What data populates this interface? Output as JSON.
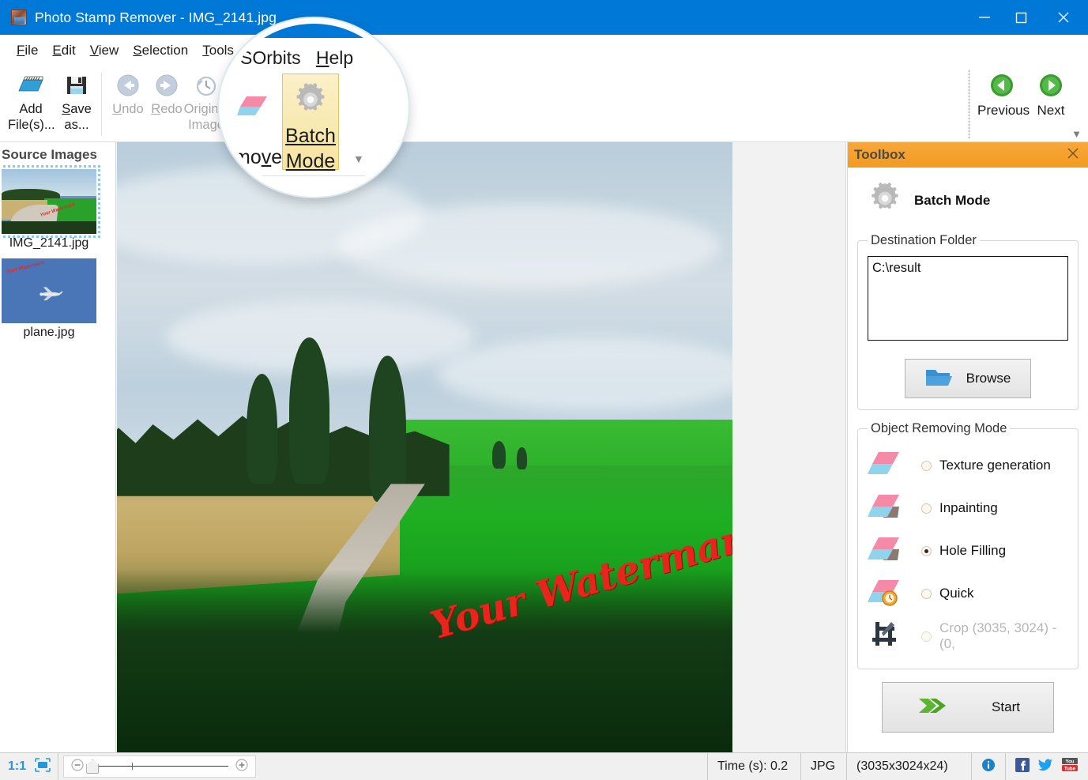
{
  "window": {
    "title": "Photo Stamp Remover - IMG_2141.jpg",
    "app_icon": "app-icon",
    "minimize": "–",
    "maximize": "□",
    "close": "✕",
    "titlebar_color": "#0078d7"
  },
  "menubar": {
    "items": [
      {
        "label": "File",
        "mnemonic": "F"
      },
      {
        "label": "Edit",
        "mnemonic": "E"
      },
      {
        "label": "View",
        "mnemonic": "V"
      },
      {
        "label": "Selection",
        "mnemonic": "S"
      },
      {
        "label": "Tools",
        "mnemonic": "T"
      },
      {
        "label": "SOrbits",
        "mnemonic": ""
      },
      {
        "label": "Help",
        "mnemonic": "H"
      }
    ]
  },
  "toolbar": {
    "add_files": {
      "line1": "Add",
      "line2": "File(s)...",
      "icon": "add-files-icon"
    },
    "save_as": {
      "line1": "Save",
      "line2": "as...",
      "icon": "save-as-icon"
    },
    "undo": {
      "label": "Undo",
      "icon": "undo-arrow-icon",
      "enabled": false
    },
    "redo": {
      "label": "Redo",
      "icon": "redo-arrow-icon",
      "enabled": false
    },
    "original_image": {
      "line1": "Original",
      "line2": "Image",
      "icon": "clock-history-icon",
      "enabled": false
    },
    "remove": {
      "label": "Remove",
      "partial_label": "move",
      "icon": "eraser-icon"
    },
    "batch_mode": {
      "line1": "Batch",
      "line2": "Mode",
      "icon": "gear-icon",
      "active": true
    },
    "expand_arrow": "▼"
  },
  "navigation": {
    "previous": {
      "label": "Previous",
      "icon": "green-left-arrow-icon"
    },
    "next": {
      "label": "Next",
      "icon": "green-right-arrow-icon"
    }
  },
  "source_panel": {
    "title": "Source Images",
    "items": [
      {
        "filename": "IMG_2141.jpg",
        "selected": true,
        "watermark": "Your Watermark"
      },
      {
        "filename": "plane.jpg",
        "selected": false,
        "watermark": "Your Watermark"
      }
    ]
  },
  "canvas": {
    "watermark_text": "Your Watermark",
    "watermark_color": "#e8241c"
  },
  "toolbox": {
    "header_title": "Toolbox",
    "header_color": "#f39a20",
    "close_icon": "✕",
    "section_title": "Batch Mode",
    "section_icon": "gear-icon",
    "destination": {
      "legend": "Destination Folder",
      "value": "C:\\result",
      "placeholder": "",
      "browse_label": "Browse",
      "browse_icon": "folder-icon"
    },
    "object_removing_mode": {
      "legend": "Object Removing Mode",
      "options": [
        {
          "label": "Texture generation",
          "selected": false,
          "enabled": true,
          "icon": "eraser-plain-icon"
        },
        {
          "label": "Inpainting",
          "selected": false,
          "enabled": true,
          "icon": "eraser-shadow-icon"
        },
        {
          "label": "Hole Filling",
          "selected": true,
          "enabled": true,
          "icon": "eraser-shadow-icon"
        },
        {
          "label": "Quick",
          "selected": false,
          "enabled": true,
          "icon": "eraser-clock-icon"
        },
        {
          "label": "Crop (3035, 3024) - (0,",
          "selected": false,
          "enabled": false,
          "icon": "crop-icon"
        }
      ]
    },
    "start": {
      "label": "Start",
      "icon": "green-double-arrow-icon"
    }
  },
  "statusbar": {
    "zoom_ratio": "1:1",
    "fit_icon": "fit-to-window-icon",
    "zoom_out_icon": "−",
    "zoom_in_icon": "+",
    "time_label": "Time (s): 0.2",
    "format": "JPG",
    "dimensions": "(3035x3024x24)",
    "info_icon": "info-icon",
    "facebook_icon": "facebook-icon",
    "twitter_icon": "twitter-icon",
    "youtube_icon": "youtube-icon"
  },
  "magnifier": {
    "menu_text": "SOrbits   Help",
    "menu_label_1": "SOrbits",
    "menu_label_2": "Help",
    "remove_partial": "move",
    "batch_line1": "Batch",
    "batch_line2": "Mode",
    "expand_arrow": "▼",
    "icon": "magnifier-callout"
  }
}
